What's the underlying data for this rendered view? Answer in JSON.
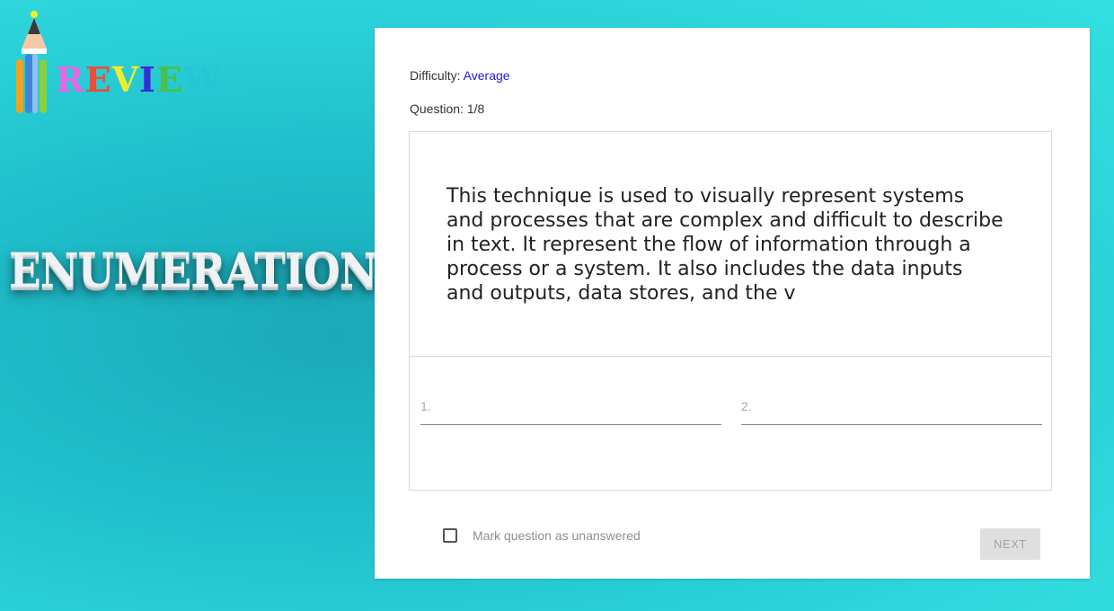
{
  "logo": {
    "letters": [
      "R",
      "E",
      "V",
      "I",
      "E",
      "W"
    ],
    "letter_colors": [
      "#e766e7",
      "#ef4c35",
      "#f0ec2c",
      "#3a2ad8",
      "#46c24a",
      "#23c7d3"
    ],
    "icon": "pencils-icon"
  },
  "side_title": "ENUMERATION",
  "quiz": {
    "difficulty_label": "Difficulty:",
    "difficulty_value": "Average",
    "question_label": "Question:",
    "question_value": "1/8",
    "question_text": "This technique is used to visually represent systems and processes that are complex and difficult to describe in text. It represent the flow of information through a process or a system. It also includes the data inputs and outputs, data stores, and the v",
    "answers": [
      {
        "placeholder": "1.",
        "value": ""
      },
      {
        "placeholder": "2.",
        "value": ""
      }
    ],
    "mark_unanswered_label": "Mark question as unanswered",
    "mark_unanswered_checked": false,
    "next_label": "NEXT"
  },
  "colors": {
    "accent_link": "#1a1adf",
    "background": "#22c4cf"
  }
}
